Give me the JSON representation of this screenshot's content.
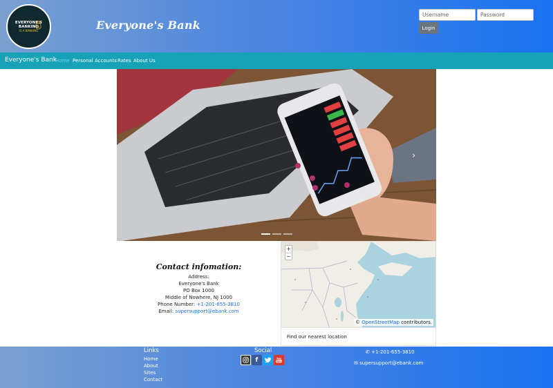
{
  "header": {
    "logo_line1": "EVERYONE'S",
    "logo_line2": "BANKING",
    "logo_line3": "IS A BANKING",
    "title": "Everyone's Bank",
    "username_placeholder": "Username",
    "password_placeholder": "Password",
    "login_label": "Login"
  },
  "nav": {
    "brand": "Everyone's Bank",
    "items": [
      {
        "label": "Home"
      },
      {
        "label": "Personal Accounts"
      },
      {
        "label": "Rates"
      },
      {
        "label": "About Us"
      }
    ]
  },
  "carousel": {
    "next_icon": "chevron-right-icon",
    "slide_count": 3,
    "active_slide": 1
  },
  "contact": {
    "title": "Contact infomation:",
    "address_label": "Address:",
    "name": "Everyone's Bank",
    "po_box": "PO Box 1000",
    "city": "Middle of Nowhere, NJ 1000",
    "phone_label": "Phone Number:",
    "phone": "+1-201-655-3810",
    "email_label": "Email:",
    "email": "supersupport@ebank.com"
  },
  "map": {
    "zoom_in": "+",
    "zoom_out": "−",
    "attribution_prefix": "©",
    "attribution_link": "OpenStreetMap",
    "attribution_suffix": "contributors.",
    "caption": "Find our nearest location"
  },
  "footer": {
    "links_heading": "Links",
    "links": [
      "Home",
      "About",
      "Sites",
      "Contact"
    ],
    "social_heading": "Social",
    "social": [
      "instagram-icon",
      "facebook-icon",
      "twitter-icon",
      "youtube-icon"
    ],
    "phone": "+1-201-655-3810",
    "email": "supersupport@ebank.com"
  },
  "colors": {
    "nav_bg": "#17a2b8",
    "header_gradient_start": "#7aa0cf",
    "header_gradient_end": "#1a72f0",
    "link": "#1a6fe0"
  }
}
